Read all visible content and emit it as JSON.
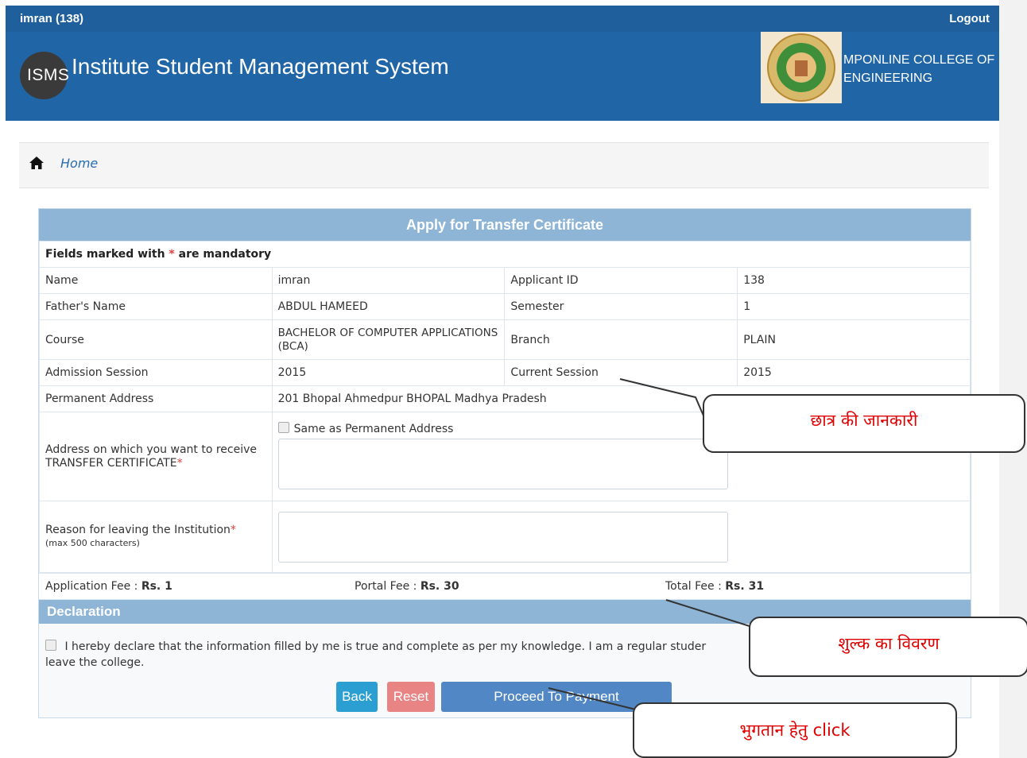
{
  "topbar": {
    "user": "imran  (138)",
    "logout": "Logout"
  },
  "header": {
    "logo_text": "ISMS",
    "title": "Institute Student Management System",
    "college_line1": "MPONLINE COLLEGE OF",
    "college_line2": "ENGINEERING"
  },
  "breadcrumb": {
    "home": "Home"
  },
  "form": {
    "title": "Apply for Transfer Certificate",
    "mandatory_note_pre": "Fields marked with ",
    "mandatory_star": "*",
    "mandatory_note_post": " are mandatory",
    "rows": [
      {
        "l1": "Name",
        "v1": "imran",
        "l2": "Applicant ID",
        "v2": "138"
      },
      {
        "l1": "Father's Name",
        "v1": "ABDUL HAMEED",
        "l2": "Semester",
        "v2": "1"
      },
      {
        "l1": "Course",
        "v1": "BACHELOR OF COMPUTER APPLICATIONS (BCA)",
        "l2": "Branch",
        "v2": "PLAIN"
      },
      {
        "l1": "Admission Session",
        "v1": "2015",
        "l2": "Current Session",
        "v2": "2015"
      }
    ],
    "permanent_address_label": "Permanent Address",
    "permanent_address_value": "201 Bhopal Ahmedpur BHOPAL Madhya Pradesh",
    "same_as_label": "Same as Permanent Address",
    "address_label": "Address on which you want to receive TRANSFER CERTIFICATE",
    "address_value": "",
    "reason_label": "Reason for leaving the Institution",
    "reason_hint": "(max 500 characters)",
    "reason_value": "",
    "required_star": "*"
  },
  "fees": {
    "application_label": "Application Fee : ",
    "application_value": "Rs. 1",
    "portal_label": "Portal Fee : ",
    "portal_value": "Rs. 30",
    "total_label": "Total Fee : ",
    "total_value": "Rs. 31"
  },
  "declaration": {
    "heading": "Declaration",
    "text": "I hereby declare that the information filled by me is true and complete as per my knowledge. I am a regular studer",
    "text_line2": "leave the college."
  },
  "buttons": {
    "back": "Back",
    "reset": "Reset",
    "proceed": "Proceed To Payment"
  },
  "annotations": {
    "student_info": "छात्र की जानकारी",
    "fee_details": "शुल्क का विवरण",
    "payment_click": "भुगतान हेतु click"
  },
  "colors": {
    "header": "#2066a6",
    "panel_header": "#8eb4d6",
    "back": "#2b9fd2",
    "reset": "#e88484",
    "proceed": "#5087c4",
    "annotation": "#e00000"
  }
}
